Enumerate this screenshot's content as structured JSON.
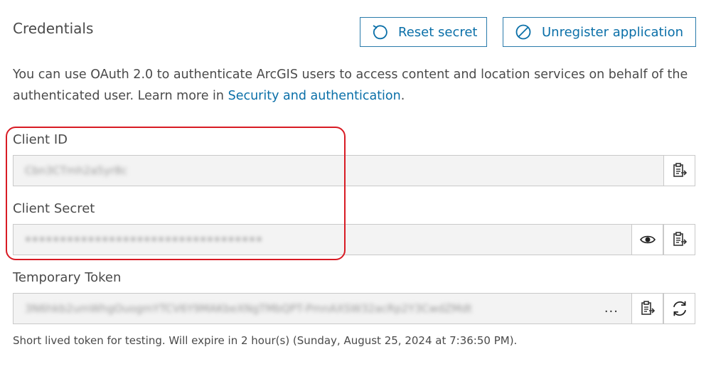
{
  "header": {
    "title": "Credentials",
    "reset_label": "Reset secret",
    "unregister_label": "Unregister application"
  },
  "description": {
    "text": "You can use OAuth 2.0 to authenticate ArcGIS users to access content and location services on behalf of the authenticated user. Learn more in",
    "link": "Security and authentication",
    "trailing": "."
  },
  "client_id": {
    "label": "Client ID",
    "value": "Cbn3CTmh2a5yr8c",
    "copy_icon": "clipboard-copy-icon"
  },
  "client_secret": {
    "label": "Client Secret",
    "value": "••••••••••••••••••••••••••••••••••",
    "show_icon": "eye-icon",
    "copy_icon": "clipboard-copy-icon"
  },
  "temporary_token": {
    "label": "Temporary Token",
    "value": "3N6hkb2umWhgOuogmYTCV6Y9MAKbeXNgTMbQPT-PmnAXSW32acRp2Y3CwdZMdt",
    "ellipsis": "...",
    "copy_icon": "clipboard-copy-icon",
    "refresh_icon": "refresh-icon"
  },
  "note": "Short lived token for testing. Will expire in 2 hour(s) (Sunday, August 25, 2024 at 7:36:50 PM).",
  "colors": {
    "accent": "#0a6fa8",
    "highlight": "#d81b24"
  }
}
